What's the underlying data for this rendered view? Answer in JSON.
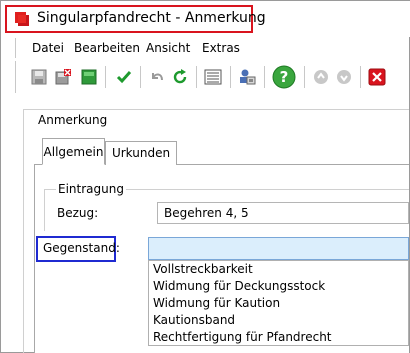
{
  "window": {
    "title": "Singularpfandrecht - Anmerkung"
  },
  "menu": {
    "items": [
      "Datei",
      "Bearbeiten",
      "Ansicht",
      "Extras"
    ]
  },
  "toolbar": {
    "icons": [
      "save-icon",
      "delete-save-icon",
      "green-square-icon",
      "checkmark-icon",
      "undo-icon",
      "refresh-icon",
      "form-icon",
      "user-print-icon",
      "help-icon",
      "up-arrow-icon",
      "down-arrow-icon",
      "close-icon"
    ]
  },
  "panel": {
    "title": "Anmerkung",
    "tabs": [
      {
        "label": "Allgemein",
        "active": true
      },
      {
        "label": "Urkunden",
        "active": false
      }
    ]
  },
  "eintragung": {
    "group_label": "Eintragung",
    "bezug_label": "Bezug:",
    "bezug_value": "Begehren 4, 5"
  },
  "gegenstand": {
    "label": "Gegenstand:",
    "value": "",
    "options": [
      "Vollstreckbarkeit",
      "Widmung für Deckungsstock",
      "Widmung für Kaution",
      "Kautionsband",
      "Rechtfertigung für Pfandrecht"
    ]
  },
  "colors": {
    "title_highlight": "#d9141e",
    "label_highlight": "#1f2ad1",
    "active_input_bg": "#dbeefc"
  }
}
